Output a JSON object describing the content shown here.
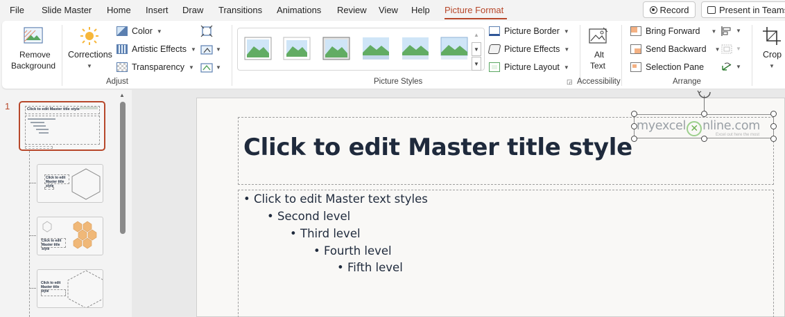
{
  "menu": {
    "items": [
      "File",
      "Slide Master",
      "Home",
      "Insert",
      "Draw",
      "Transitions",
      "Animations",
      "Review",
      "View",
      "Help",
      "Picture Format"
    ],
    "record_label": "Record",
    "present_label": "Present in Teams"
  },
  "ribbon": {
    "adjust": {
      "remove_bg_line1": "Remove",
      "remove_bg_line2": "Background",
      "corrections": "Corrections",
      "color": "Color",
      "artistic_effects": "Artistic Effects",
      "transparency": "Transparency",
      "group_label": "Adjust"
    },
    "picture_styles": {
      "group_label": "Picture Styles",
      "picture_border": "Picture Border",
      "picture_effects": "Picture Effects",
      "picture_layout": "Picture Layout"
    },
    "accessibility": {
      "alt_text_line1": "Alt",
      "alt_text_line2": "Text",
      "group_label": "Accessibility"
    },
    "arrange": {
      "bring_forward": "Bring Forward",
      "send_backward": "Send Backward",
      "selection_pane": "Selection Pane",
      "group_label": "Arrange"
    },
    "size": {
      "crop": "Crop"
    }
  },
  "thumbnails": {
    "slide_number": "1",
    "master_title": "Click to edit Master title style",
    "layout_title": "Click to edit Master title style"
  },
  "slide": {
    "title": "Click to edit Master title style",
    "body_levels": [
      "Click to edit Master text styles",
      "Second level",
      "Third level",
      "Fourth level",
      "Fifth level"
    ],
    "logo_text_a": "myexcel",
    "logo_text_b": "nline.com",
    "logo_tagline": "Excel out here the most"
  },
  "colors": {
    "accent": "#b7472a",
    "title_text": "#1f2a3c"
  }
}
